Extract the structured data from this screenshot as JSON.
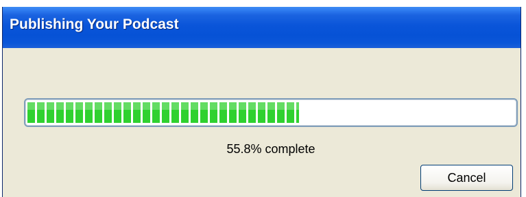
{
  "window": {
    "title": "Publishing Your Podcast"
  },
  "progress": {
    "percent": 55.8,
    "status_text": "55.8% complete",
    "fill_color": "#2fd12f"
  },
  "buttons": {
    "cancel_label": "Cancel"
  },
  "colors": {
    "titlebar": "#0a55d9",
    "dialog_background": "#ece9d8"
  }
}
